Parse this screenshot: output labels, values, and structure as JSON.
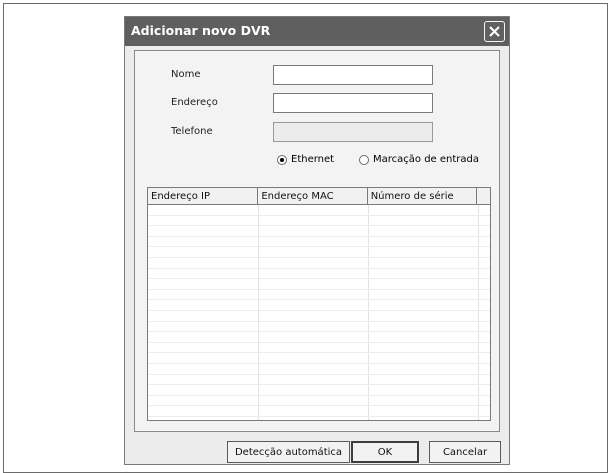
{
  "dialog": {
    "title": "Adicionar novo DVR"
  },
  "form": {
    "name_label": "Nome",
    "name_value": "",
    "address_label": "Endereço",
    "address_value": "",
    "phone_label": "Telefone",
    "phone_value": ""
  },
  "connection": {
    "ethernet_label": "Ethernet",
    "ethernet_selected": true,
    "dialin_label": "Marcação de entrada",
    "dialin_selected": false
  },
  "device_list": {
    "columns": [
      "Endereço IP",
      "Endereço MAC",
      "Número de série"
    ],
    "rows": []
  },
  "buttons": {
    "auto_detect": "Detecção automática",
    "ok": "OK",
    "cancel": "Cancelar"
  }
}
